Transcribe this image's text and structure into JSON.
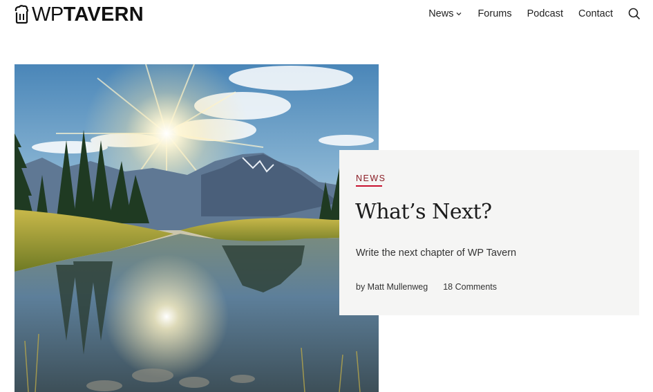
{
  "site": {
    "logo_prefix": "WP",
    "logo_name": "TAVERN"
  },
  "nav": {
    "items": [
      {
        "label": "News",
        "has_dropdown": true
      },
      {
        "label": "Forums"
      },
      {
        "label": "Podcast"
      },
      {
        "label": "Contact"
      }
    ],
    "search_icon": "search-icon"
  },
  "featured": {
    "category": "NEWS",
    "title": "What’s Next?",
    "excerpt": "Write the next chapter of WP Tavern",
    "author": "by Matt Mullenweg",
    "comments": "18 Comments",
    "image_description_icon": "landscape-image"
  },
  "colors": {
    "accent": "#c8102e",
    "card_bg": "#f5f5f4",
    "text": "#1e1e1e"
  }
}
